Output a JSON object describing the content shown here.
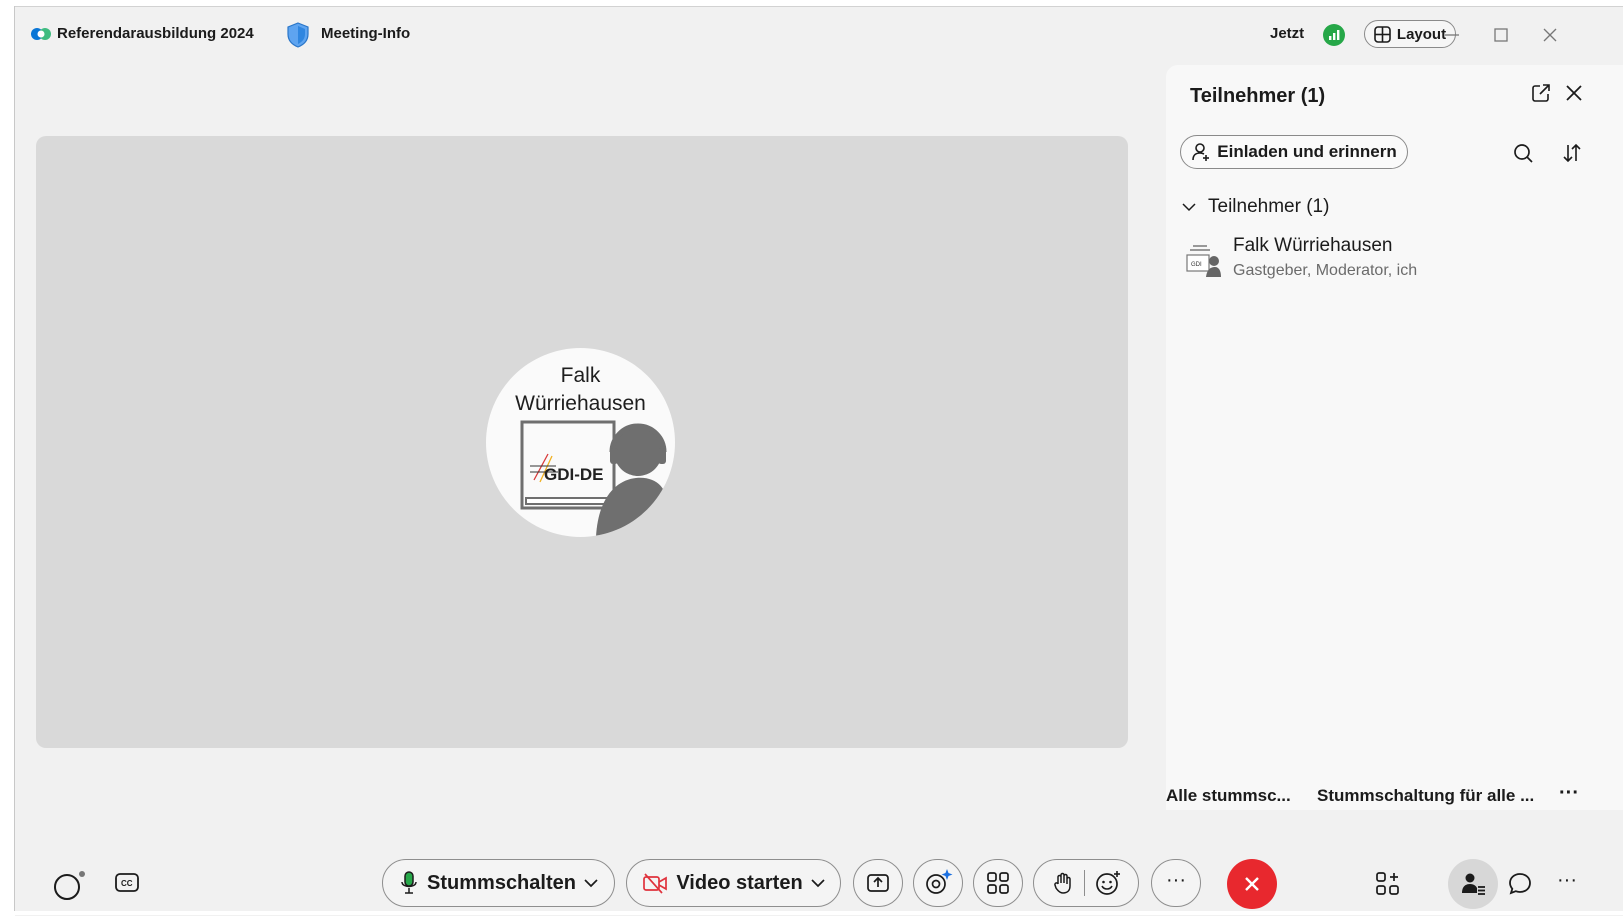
{
  "titlebar": {
    "meeting_title": "Referendarausbildung 2024",
    "meeting_info_label": "Meeting-Info",
    "time_label": "Jetzt",
    "layout_label": "Layout"
  },
  "stage": {
    "avatar_name_line1": "Falk",
    "avatar_name_line2": "Würriehausen",
    "avatar_logo_text": "GDI-DE"
  },
  "participants_panel": {
    "title": "Teilnehmer (1)",
    "invite_label": "Einladen und erinnern",
    "group_label": "Teilnehmer (1)",
    "participants": [
      {
        "name": "Falk Würriehausen",
        "role": "Gastgeber, Moderator, ich"
      }
    ],
    "mute_all_label": "Alle stummsc...",
    "unmute_all_label": "Stummschaltung für alle ...",
    "more_label": "···"
  },
  "toolbar": {
    "mute_label": "Stummschalten",
    "video_label": "Video starten",
    "more_label": "···",
    "right_more_label": "···"
  },
  "colors": {
    "accent_green": "#26a748",
    "end_call_red": "#e8282e",
    "video_off_red": "#e0323c",
    "background": "#f1f1f1"
  },
  "icons": [
    "webex-logo-icon",
    "shield-icon",
    "signal-icon",
    "layout-icon",
    "minimize-icon",
    "maximize-icon",
    "close-icon",
    "popout-icon",
    "panel-close-icon",
    "add-person-icon",
    "search-icon",
    "sort-icon",
    "chevron-down-icon",
    "status-ring-icon",
    "captions-icon",
    "microphone-icon",
    "video-off-icon",
    "share-icon",
    "ai-assistant-icon",
    "apps-grid-icon",
    "raise-hand-icon",
    "reactions-icon",
    "end-call-icon",
    "apps-add-icon",
    "participants-icon",
    "chat-icon"
  ]
}
